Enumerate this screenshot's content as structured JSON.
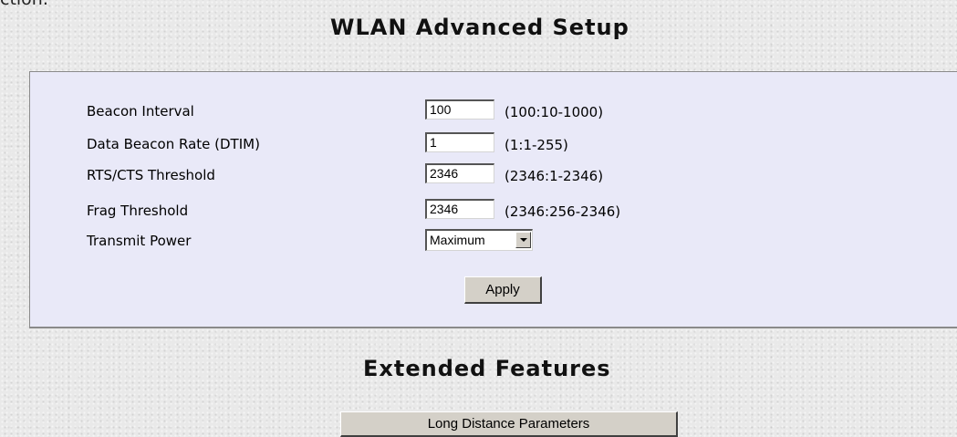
{
  "top_fragment": "ction.",
  "main_heading": "WLAN Advanced Setup",
  "settings": [
    {
      "label": "Beacon Interval",
      "value": "100",
      "range": "(100:10-1000)"
    },
    {
      "label": "Data Beacon Rate (DTIM)",
      "value": "1",
      "range": "(1:1-255)"
    },
    {
      "label": "RTS/CTS Threshold",
      "value": "2346",
      "range": "(2346:1-2346)"
    },
    {
      "label": "Frag Threshold",
      "value": "2346",
      "range": "(2346:256-2346)"
    }
  ],
  "transmit_power": {
    "label": "Transmit Power",
    "selected": "Maximum"
  },
  "apply_label": "Apply",
  "extended_heading": "Extended Features",
  "long_distance_label": "Long Distance Parameters"
}
